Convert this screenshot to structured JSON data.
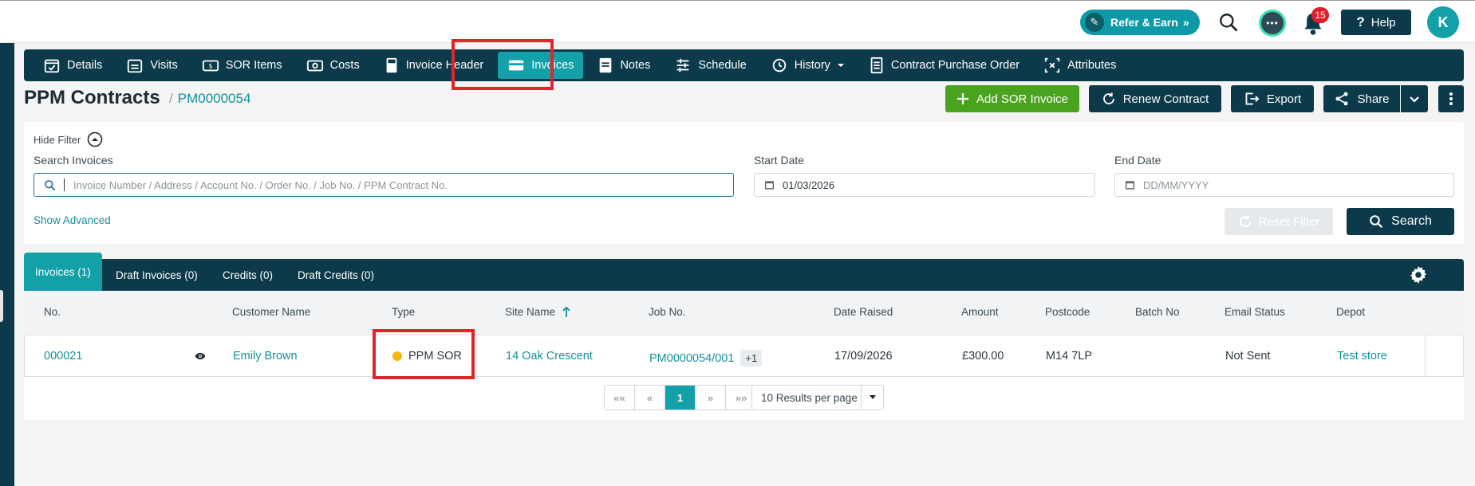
{
  "topbar": {
    "refer_label": "Refer & Earn",
    "refer_chevrons": "»",
    "notification_count": "15",
    "help_label": "Help",
    "avatar_initial": "K"
  },
  "nav": {
    "items": [
      {
        "label": "Details",
        "icon": "calendar-check-icon"
      },
      {
        "label": "Visits",
        "icon": "calendar-list-icon"
      },
      {
        "label": "SOR Items",
        "icon": "money-bill-icon"
      },
      {
        "label": "Costs",
        "icon": "cash-icon"
      },
      {
        "label": "Invoice Header",
        "icon": "calculator-icon"
      },
      {
        "label": "Invoices",
        "icon": "card-icon",
        "active": true
      },
      {
        "label": "Notes",
        "icon": "note-icon"
      },
      {
        "label": "Schedule",
        "icon": "sliders-icon"
      },
      {
        "label": "History",
        "icon": "history-icon"
      },
      {
        "label": "Contract Purchase Order",
        "icon": "receipt-icon"
      },
      {
        "label": "Attributes",
        "icon": "attributes-icon"
      }
    ]
  },
  "header": {
    "title": "PPM Contracts",
    "separator": "/",
    "contract_id": "PM0000054",
    "buttons": {
      "add_sor_invoice": "Add SOR Invoice",
      "renew_contract": "Renew Contract",
      "export": "Export",
      "share": "Share"
    }
  },
  "filter": {
    "hide_label": "Hide Filter",
    "search_label": "Search Invoices",
    "search_placeholder": "Invoice Number / Address / Account No. / Order No. / Job No. / PPM Contract No.",
    "start_label": "Start Date",
    "start_value": "01/03/2026",
    "end_label": "End Date",
    "end_placeholder": "DD/MM/YYYY",
    "show_advanced": "Show Advanced",
    "reset_label": "Reset Filter",
    "search_button": "Search"
  },
  "tabs": [
    {
      "label": "Invoices (1)",
      "active": true
    },
    {
      "label": "Draft Invoices (0)"
    },
    {
      "label": "Credits (0)"
    },
    {
      "label": "Draft Credits (0)"
    }
  ],
  "table": {
    "columns": [
      "No.",
      "Customer Name",
      "Type",
      "Site Name",
      "Job No.",
      "Date Raised",
      "Amount",
      "Postcode",
      "Batch No",
      "Email Status",
      "Depot"
    ],
    "rows": [
      {
        "no": "000021",
        "customer": "Emily Brown",
        "type": "PPM SOR",
        "type_color": "#f5b80a",
        "site": "14 Oak Crescent",
        "job": "PM0000054/001",
        "job_extra": "+1",
        "date_raised": "17/09/2026",
        "amount": "£300.00",
        "postcode": "M14 7LP",
        "batch": "",
        "email_status": "Not Sent",
        "depot": "Test store"
      }
    ]
  },
  "pagination": {
    "first": "««",
    "prev": "«",
    "current": "1",
    "next": "»",
    "last": "»»",
    "per_page": "10 Results per page"
  }
}
